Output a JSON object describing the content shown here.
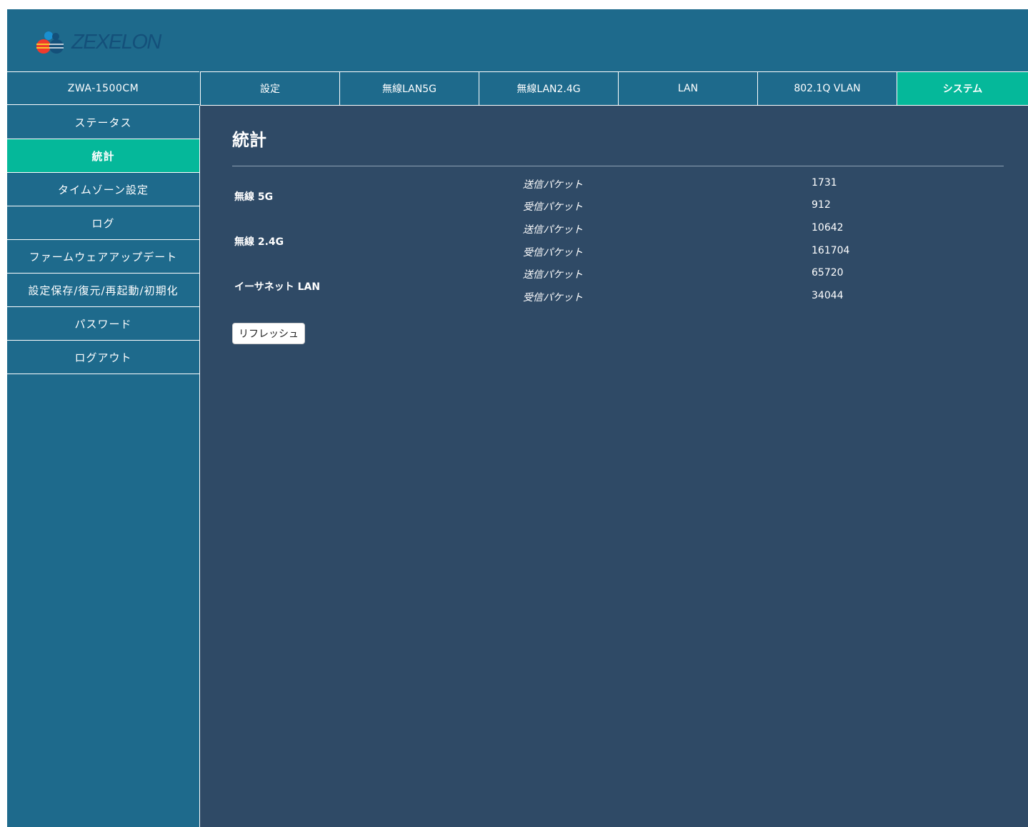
{
  "brand": {
    "name": "ZEXELON"
  },
  "model": "ZWA-1500CM",
  "tabs": [
    {
      "label": "設定"
    },
    {
      "label": "無線LAN5G"
    },
    {
      "label": "無線LAN2.4G"
    },
    {
      "label": "LAN"
    },
    {
      "label": "802.1Q VLAN"
    },
    {
      "label": "システム"
    }
  ],
  "sidebar": {
    "items": [
      {
        "label": "ステータス"
      },
      {
        "label": "統計"
      },
      {
        "label": "タイムゾーン設定"
      },
      {
        "label": "ログ"
      },
      {
        "label": "ファームウェアアップデート"
      },
      {
        "label": "設定保存/復元/再起動/初期化"
      },
      {
        "label": "パスワード"
      },
      {
        "label": "ログアウト"
      }
    ]
  },
  "main": {
    "title": "統計",
    "groups": [
      {
        "label": "無線 5G",
        "tx_label": "送信パケット",
        "tx": "1731",
        "rx_label": "受信パケット",
        "rx": "912"
      },
      {
        "label": "無線 2.4G",
        "tx_label": "送信パケット",
        "tx": "10642",
        "rx_label": "受信パケット",
        "rx": "161704"
      },
      {
        "label": "イーサネット LAN",
        "tx_label": "送信パケット",
        "tx": "65720",
        "rx_label": "受信パケット",
        "rx": "34044"
      }
    ],
    "refresh_label": "リフレッシュ"
  },
  "colors": {
    "header": "#1e6a8c",
    "accent": "#05b89a",
    "content_bg": "#2f4a66"
  }
}
